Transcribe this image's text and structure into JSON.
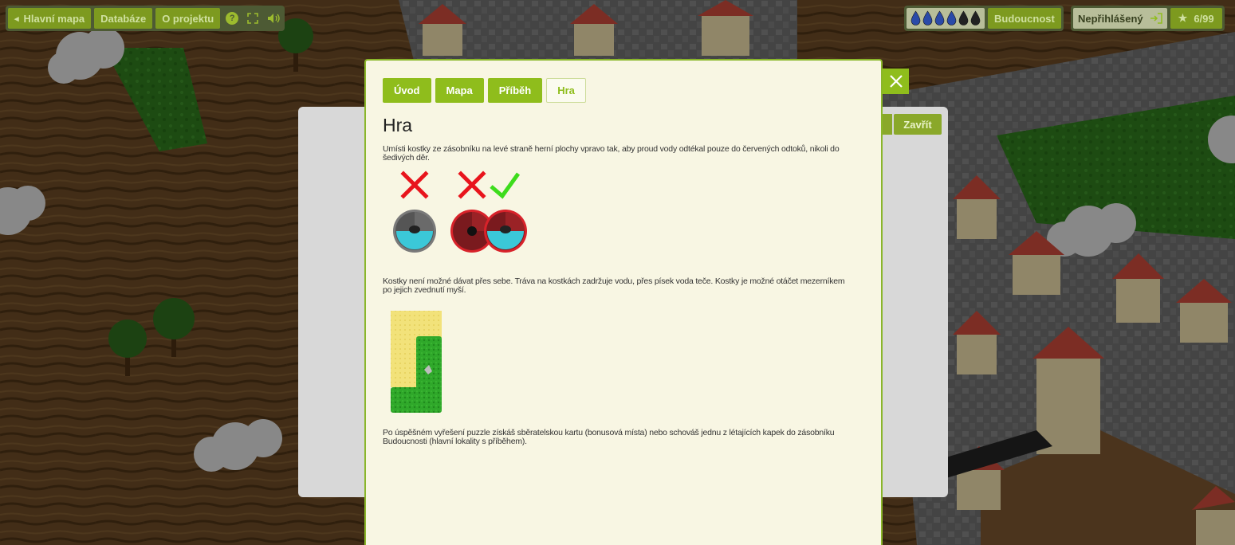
{
  "toolbar": {
    "back_label": "Hlavní mapa",
    "back_icon": "chevron-left-icon",
    "database_label": "Databáze",
    "about_label": "O projektu",
    "help_icon": "help-icon",
    "fullscreen_icon": "fullscreen-icon",
    "sound_icon": "sound-icon"
  },
  "drops": {
    "count": 6,
    "filled": 4,
    "label": "Budoucnost"
  },
  "user": {
    "status_label": "Nepřihlášený",
    "login_icon": "login-icon",
    "star_icon": "star-icon",
    "score": "6/99"
  },
  "background_panel": {
    "close_label": "Zavřít"
  },
  "modal": {
    "tabs": [
      {
        "label": "Úvod",
        "active": false
      },
      {
        "label": "Mapa",
        "active": false
      },
      {
        "label": "Příběh",
        "active": false
      },
      {
        "label": "Hra",
        "active": true
      }
    ],
    "title": "Hra",
    "paragraph1": "Umísti kostky ze zásobníku na levé straně herní plochy vpravo tak, aby proud vody odtékal pouze do červených odtoků, nikoli do šedivých děr.",
    "paragraph2": "Kostky není možné dávat přes sebe. Tráva na kostkách zadržuje vodu, přes písek voda teče. Kostky je možné otáčet mezerníkem po jejich zvednutí myší.",
    "paragraph3": "Po úspěšném vyřešení puzzle získáš sběratelskou kartu (bonusová místa) nebo schováš jednu z létajících kapek do zásobníku Budoucnosti (hlavní lokality s příběhem).",
    "hints": [
      {
        "mark": "cross",
        "hole": "grey-water"
      },
      {
        "mark": "cross",
        "hole": "red-empty"
      },
      {
        "mark": "check",
        "hole": "red-water"
      }
    ]
  },
  "colors": {
    "accent": "#8fbd1c",
    "modal_bg": "#f8f6e3",
    "cross": "#e8141c",
    "check": "#3ddc1c",
    "water": "#3bc8d8"
  }
}
